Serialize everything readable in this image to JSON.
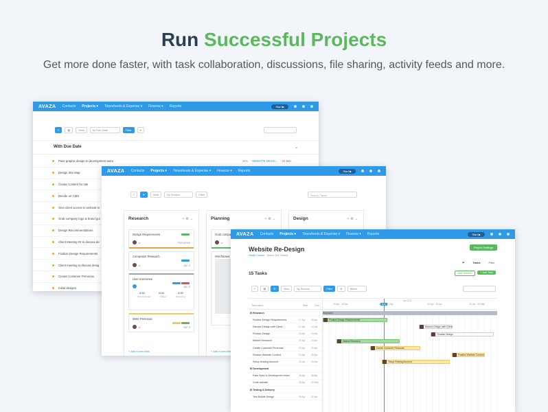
{
  "hero": {
    "title_a": "Run",
    "title_b": "Successful Projects",
    "subtitle": "Get more done faster, with task collaboration, discussions, file sharing, activity feeds and more."
  },
  "nav": {
    "logo": "AVAZA",
    "contacts": "Contacts",
    "projects": "Projects ▾",
    "timesheets": "Timesheets & Expense ▾",
    "finance": "Finance ▾",
    "reports": "Reports",
    "start": "Start ▶"
  },
  "list_view": {
    "view_label": "View",
    "sort": "by Due Date",
    "filter": "Filter",
    "section_title": "With Due Date",
    "first_task_meta": {
      "percent": "30%",
      "link": "WEBSITE DESIG...",
      "date": "22 Mar"
    },
    "tasks": [
      "Pass graphic design to development team",
      "Design Site Map",
      "Create Content for site",
      "Decide on CMS",
      "Give client access to website re",
      "Grab company logo & brand gui",
      "Design Recommendations",
      "Client Meeting #2 to discuss de",
      "Finalize Design Requirements",
      "Client meeting to discuss desig",
      "Create Customer Personas",
      "Initial designs"
    ]
  },
  "board_view": {
    "view_label": "View",
    "sort": "by Section",
    "filter": "Filter",
    "search_placeholder": "Search Tasks",
    "add_task": "+ Add a new task",
    "columns": [
      {
        "title": "Research",
        "cards": [
          {
            "title": "Design Requirements",
            "date": "Tomorrow"
          },
          {
            "title": "Competitor Research",
            "date": "Jun 4"
          },
          {
            "title": "User Interviews",
            "date": "Jun 6",
            "est": "4:30",
            "act": "0:00",
            "rem": "4:30",
            "est_lbl": "Time Estimate",
            "act_lbl": "Actual",
            "rem_lbl": "Remaining"
          },
          {
            "title": "Write Personas",
            "date": "Jun 4"
          }
        ]
      },
      {
        "title": "Planning",
        "cards": [
          {
            "title": "Grab company logo & brand guide",
            "date": ""
          },
          {
            "title": "Wireframes",
            "date": ""
          }
        ]
      },
      {
        "title": "Design",
        "cards": []
      }
    ]
  },
  "gantt_view": {
    "project": "Website Re-Design",
    "client": "Health Charter",
    "status": "Status: Not Started",
    "settings": "Project Settings",
    "tab_tasks": "Tasks",
    "tab_files": "Files",
    "count": "15 Tasks",
    "add_section": "Add Section",
    "add_task": "+ Add Task",
    "view_label": "View",
    "sort": "by Section",
    "filter": "Filter",
    "period": "Week",
    "col_name": "Task name",
    "col_start": "Start",
    "col_due": "Due",
    "month": "Apr 2017",
    "weeks": [
      "09 Apr - 15 Apr",
      "16 Apr - 22 Apr",
      "23 Apr - 29 Apr",
      "30 Apr - 06 May"
    ],
    "today": "Now",
    "rows": [
      {
        "name": "Research",
        "section": true,
        "start": "",
        "due": ""
      },
      {
        "name": "Finalize Design Requirements",
        "start": "17 Apr",
        "due": "28 Apr"
      },
      {
        "name": "Discuss Design with Client",
        "start": "17 Apr",
        "due": "10 Apr"
      },
      {
        "name": "Finalize Design",
        "start": "20 Apr",
        "due": "24 Apr"
      },
      {
        "name": "Market Research",
        "start": "21 Apr",
        "due": "24 Apr"
      },
      {
        "name": "Create Customer Personas",
        "start": "24 Apr",
        "due": "29 Apr"
      },
      {
        "name": "Finalize Website Content",
        "start": "24 Apr",
        "due": "28 Apr"
      },
      {
        "name": "Setup Hosting Account",
        "start": "25 Apr",
        "due": "25 Apr"
      },
      {
        "name": "Development",
        "section": true,
        "start": "",
        "due": ""
      },
      {
        "name": "Pass Spec to Development team",
        "start": "28 Apr",
        "due": "28 Apr"
      },
      {
        "name": "Code website",
        "start": "28 Apr",
        "due": "04 May"
      },
      {
        "name": "Testing & Delivery",
        "section": true,
        "start": "",
        "due": ""
      },
      {
        "name": "Test Mobile Design",
        "start": "20 Apr",
        "due": "22 Apr"
      }
    ],
    "bars": [
      {
        "row": 0,
        "label": "Research",
        "start": 0.0,
        "end": 1.0,
        "style": "gray"
      },
      {
        "row": 1,
        "label": "Finalize Design Requirements",
        "start": 0.0,
        "end": 0.37,
        "style": "green"
      },
      {
        "row": 2,
        "label": "Discuss Design with Client",
        "start": 0.55,
        "end": 0.74,
        "style": "white"
      },
      {
        "row": 3,
        "label": "Finalize Design",
        "start": 0.62,
        "end": 0.98,
        "style": "white"
      },
      {
        "row": 4,
        "label": "Market Research",
        "start": 0.08,
        "end": 0.44,
        "style": "green"
      },
      {
        "row": 5,
        "label": "Create Customer Personas",
        "start": 0.27,
        "end": 0.56,
        "style": "yellow"
      },
      {
        "row": 6,
        "label": "Finalize Website Content",
        "start": 0.74,
        "end": 0.93,
        "style": "yellow"
      },
      {
        "row": 7,
        "label": "Setup Hosting Account",
        "start": 0.34,
        "end": 0.73,
        "style": "yellow"
      }
    ],
    "today_pos": 0.35
  }
}
